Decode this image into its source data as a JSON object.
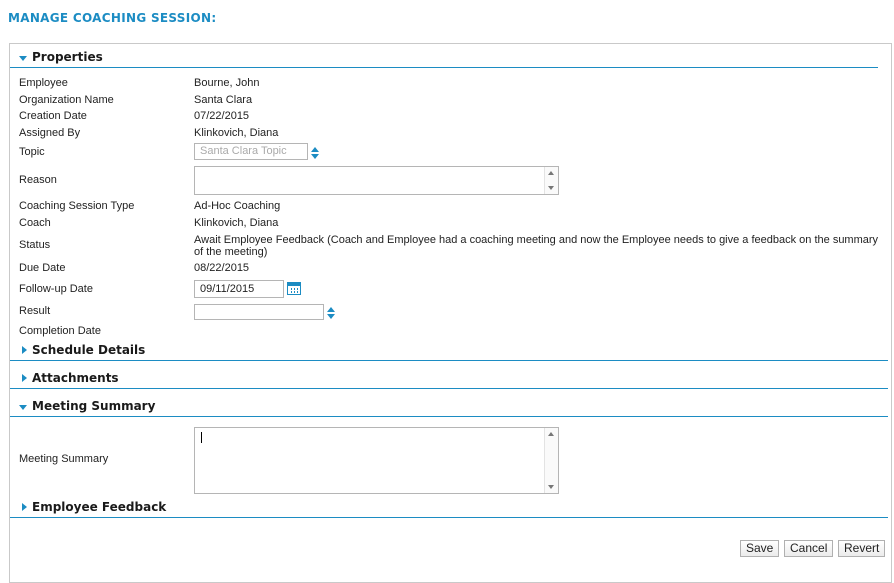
{
  "page": {
    "title": "MANAGE COACHING SESSION:"
  },
  "properties": {
    "header": "Properties",
    "employee": {
      "label": "Employee",
      "value": "Bourne, John"
    },
    "organization": {
      "label": "Organization Name",
      "value": "Santa Clara"
    },
    "creation_date": {
      "label": "Creation Date",
      "value": "07/22/2015"
    },
    "assigned_by": {
      "label": "Assigned By",
      "value": "Klinkovich, Diana"
    },
    "topic": {
      "label": "Topic",
      "value": "Santa Clara Topic"
    },
    "reason": {
      "label": "Reason",
      "value": ""
    },
    "session_type": {
      "label": "Coaching Session Type",
      "value": "Ad-Hoc Coaching"
    },
    "coach": {
      "label": "Coach",
      "value": "Klinkovich, Diana"
    },
    "status": {
      "label": "Status",
      "value": "Await Employee Feedback (Coach and Employee had a coaching meeting and now the Employee needs to give a feedback on the summary of the meeting)"
    },
    "due_date": {
      "label": "Due Date",
      "value": "08/22/2015"
    },
    "followup_date": {
      "label": "Follow-up Date",
      "value": "09/11/2015"
    },
    "result": {
      "label": "Result",
      "value": ""
    },
    "completion_date": {
      "label": "Completion Date",
      "value": ""
    }
  },
  "sections": {
    "schedule": "Schedule Details",
    "attachments": "Attachments",
    "meeting": "Meeting Summary",
    "feedback": "Employee Feedback"
  },
  "meeting_summary": {
    "label": "Meeting Summary",
    "value": ""
  },
  "buttons": {
    "save": "Save",
    "cancel": "Cancel",
    "revert": "Revert"
  },
  "colors": {
    "accent": "#1c8cc3",
    "border": "#c9c9c9"
  },
  "icons": {
    "expanded": "triangle-down-icon",
    "collapsed": "triangle-right-icon",
    "spinner": "up-down-arrows-icon",
    "calendar": "calendar-icon"
  }
}
